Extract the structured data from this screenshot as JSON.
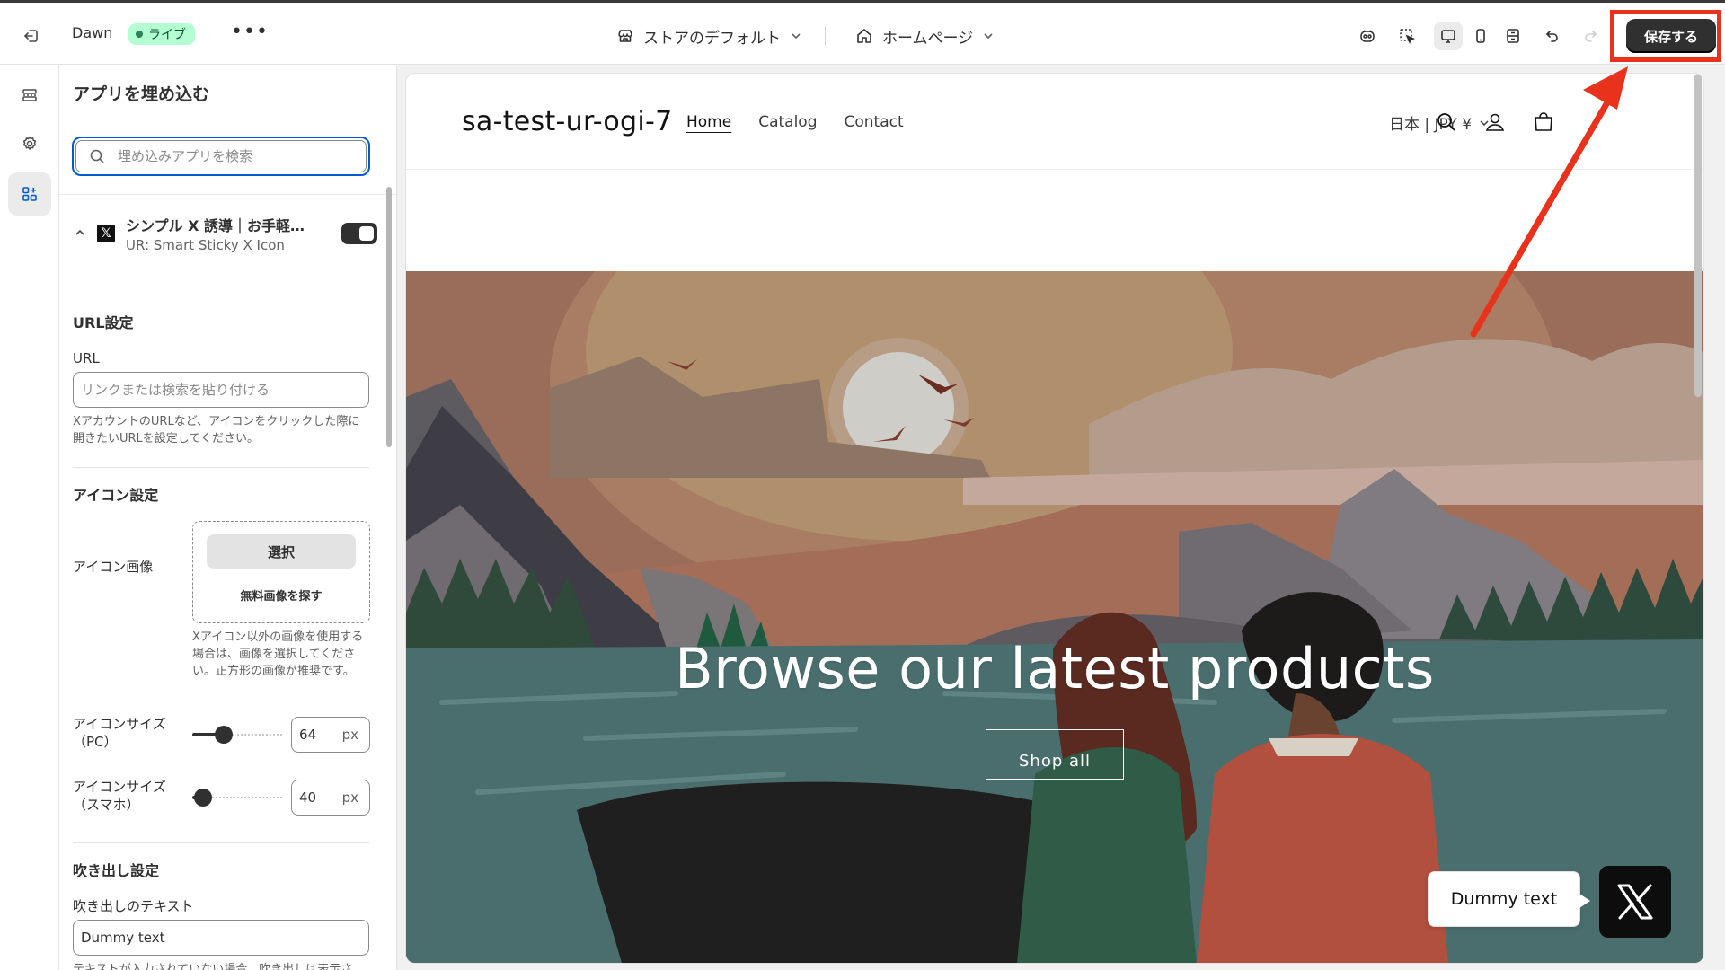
{
  "topbar": {
    "theme_name": "Dawn",
    "live_badge": "ライブ",
    "more_label": "•••",
    "store_select": "ストアのデフォルト",
    "page_select": "ホームページ",
    "save_label": "保存する"
  },
  "panel": {
    "title": "アプリを埋め込む",
    "search_placeholder": "埋め込みアプリを検索",
    "app_name": "シンプル X 誘導｜お手軽…",
    "app_subtitle": "UR: Smart Sticky X Icon",
    "url_section": "URL設定",
    "url_label": "URL",
    "url_placeholder": "リンクまたは検索を貼り付ける",
    "url_help": "XアカウントのURLなど、アイコンをクリックした際に開きたいURLを設定してください。",
    "icon_section": "アイコン設定",
    "icon_image_label": "アイコン画像",
    "icon_select_button": "選択",
    "icon_free_link": "無料画像を探す",
    "icon_help": "Xアイコン以外の画像を使用する場合は、画像を選択してください。正方形の画像が推奨です。",
    "size_pc_label_1": "アイコンサイズ",
    "size_pc_label_2": "（PC）",
    "size_pc_value": "64",
    "size_pc_fraction": 0.35,
    "size_sp_label_1": "アイコンサイズ",
    "size_sp_label_2": "（スマホ）",
    "size_sp_value": "40",
    "size_sp_fraction": 0.12,
    "unit": "px",
    "bubble_section": "吹き出し設定",
    "bubble_text_label": "吹き出しのテキスト",
    "bubble_text_value": "Dummy text",
    "bubble_help_cut": "テキストが入力されていない場合、吹き出しは表示さ"
  },
  "preview": {
    "store_name": "sa-test-ur-ogi-7",
    "nav": [
      "Home",
      "Catalog",
      "Contact"
    ],
    "currency": "日本 | JPY ¥",
    "hero_title": "Browse our latest products",
    "hero_button": "Shop all",
    "bubble_text": "Dummy text"
  },
  "colors": {
    "accent": "#005bd3",
    "save_button": "#303030",
    "highlight": "#e8321b",
    "live_badge_bg": "#b4fed2"
  }
}
